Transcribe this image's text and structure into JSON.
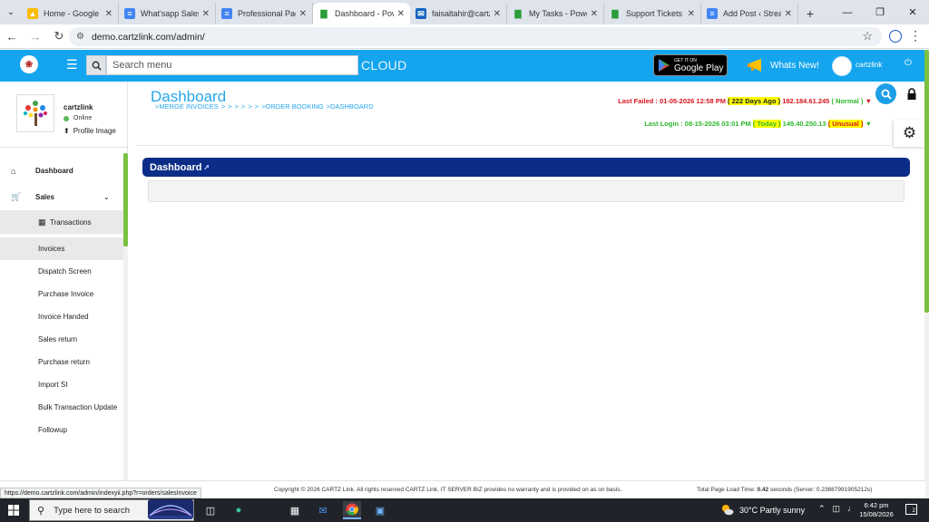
{
  "browser": {
    "tabs": [
      {
        "title": "Home - Google Dr",
        "active": false
      },
      {
        "title": "What'sapp Sales M",
        "active": false
      },
      {
        "title": "Professional Packa",
        "active": false
      },
      {
        "title": "Dashboard - Powe",
        "active": true
      },
      {
        "title": "faisaltahir@cartzli",
        "active": false
      },
      {
        "title": "My Tasks - Powerf",
        "active": false
      },
      {
        "title": "Support Tickets - ",
        "active": false
      },
      {
        "title": "Add Post ‹ Stream",
        "active": false
      }
    ],
    "url": "demo.cartzlink.com/admin/",
    "status_url": "https://demo.cartzlink.com/admin/indexyii.php?r=orders/salesInvoice"
  },
  "header": {
    "search_placeholder": "Search menu",
    "cloud_label": "CLOUD",
    "google_play_top": "GET IT ON",
    "google_play_bottom": "Google Play",
    "whats_new": "Whats New!",
    "username": "cartzlink",
    "accent": "#14a5ee"
  },
  "sidebar": {
    "username": "cartzlink",
    "status": "Online",
    "profile_link": "Profile Image",
    "menu": {
      "dashboard": "Dashboard",
      "sales": "Sales",
      "transactions": "Transactions",
      "items": [
        "Invoices",
        "Dispatch Screen",
        "Purchase Invoice",
        "Invoice Handed",
        "Sales return",
        "Purchase return",
        "Import SI",
        "Bulk Transaction Update",
        "Followup"
      ]
    }
  },
  "main": {
    "title": "Dashboard",
    "breadcrumbs": [
      ">MERGE INVOICES",
      ">",
      ">",
      ">",
      ">",
      ">",
      ">",
      ">ORDER BOOKING",
      ">DASHBOARD"
    ],
    "last_failed": {
      "label": "Last Failed : 01-05-2026 12:58 PM",
      "ago": "( 222 Days Ago )",
      "ip": "182.184.61.245",
      "status": "( Normal )",
      "arrow": "▼"
    },
    "last_login": {
      "label": "Last Login : 08-15-2026 03:01 PM",
      "ago": "( Today )",
      "ip": "149.40.250.13",
      "status": "( Unusual )",
      "arrow": "▼"
    },
    "panel_title": "Dashboard",
    "panel_color": "#0c2d87"
  },
  "footer": {
    "copyright": "Copyright © 2026 CARTZ Link. All rights reserved CARTZ Link. IT SERVER BIZ provides no warranty and is provided on as on basis.",
    "load_label": "Total Page Load Time:",
    "load_value": "0.42",
    "load_suffix": "seconds (Server: 0.23887991905212s)"
  },
  "taskbar": {
    "search_placeholder": "Type here to search",
    "weather": "30°C  Partly sunny",
    "time": "6:42 pm",
    "date": "15/08/2026",
    "notifications": "2"
  }
}
